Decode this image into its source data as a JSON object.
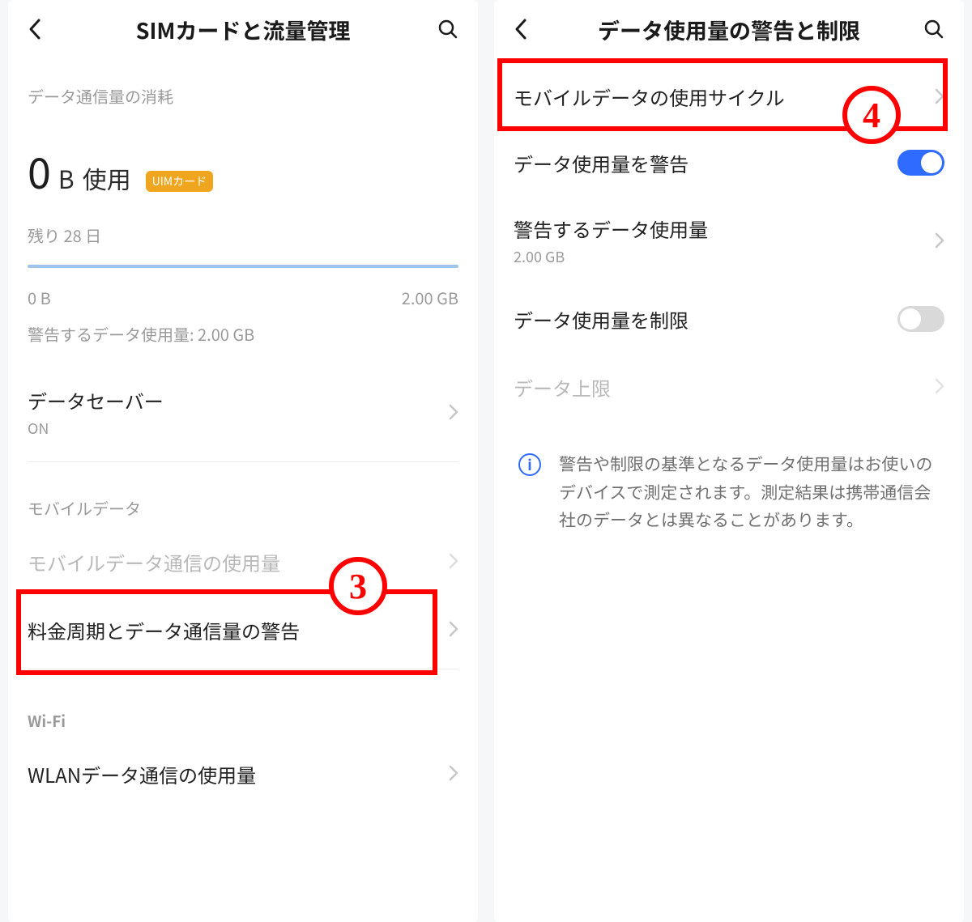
{
  "left": {
    "header": {
      "title": "SIMカードと流量管理"
    },
    "consumption_header": "データ通信量の消耗",
    "usage": {
      "value": "0",
      "unit": "B",
      "used_label": "使用",
      "badge": "UIMカード"
    },
    "remaining": "残り 28 日",
    "range_min": "0 B",
    "range_max": "2.00 GB",
    "warn_line": "警告するデータ使用量: 2.00 GB",
    "data_saver": {
      "title": "データセーバー",
      "status": "ON"
    },
    "mobile_section": "モバイルデータ",
    "mobile_usage_row": "モバイルデータ通信の使用量",
    "billing_cycle_row": "料金周期とデータ通信量の警告",
    "wifi_section": "Wi-Fi",
    "wlan_row": "WLANデータ通信の使用量",
    "annot_number": "3"
  },
  "right": {
    "header": {
      "title": "データ使用量の警告と制限"
    },
    "cycle_row": "モバイルデータの使用サイクル",
    "warn_toggle": {
      "label": "データ使用量を警告",
      "on": true
    },
    "warn_amount": {
      "label": "警告するデータ使用量",
      "value": "2.00 GB"
    },
    "limit_toggle": {
      "label": "データ使用量を制限",
      "on": false
    },
    "limit_row": {
      "label": "データ上限"
    },
    "info": "警告や制限の基準となるデータ使用量はお使いのデバイスで測定されます。測定結果は携帯通信会社のデータとは異なることがあります。",
    "annot_number": "4"
  }
}
